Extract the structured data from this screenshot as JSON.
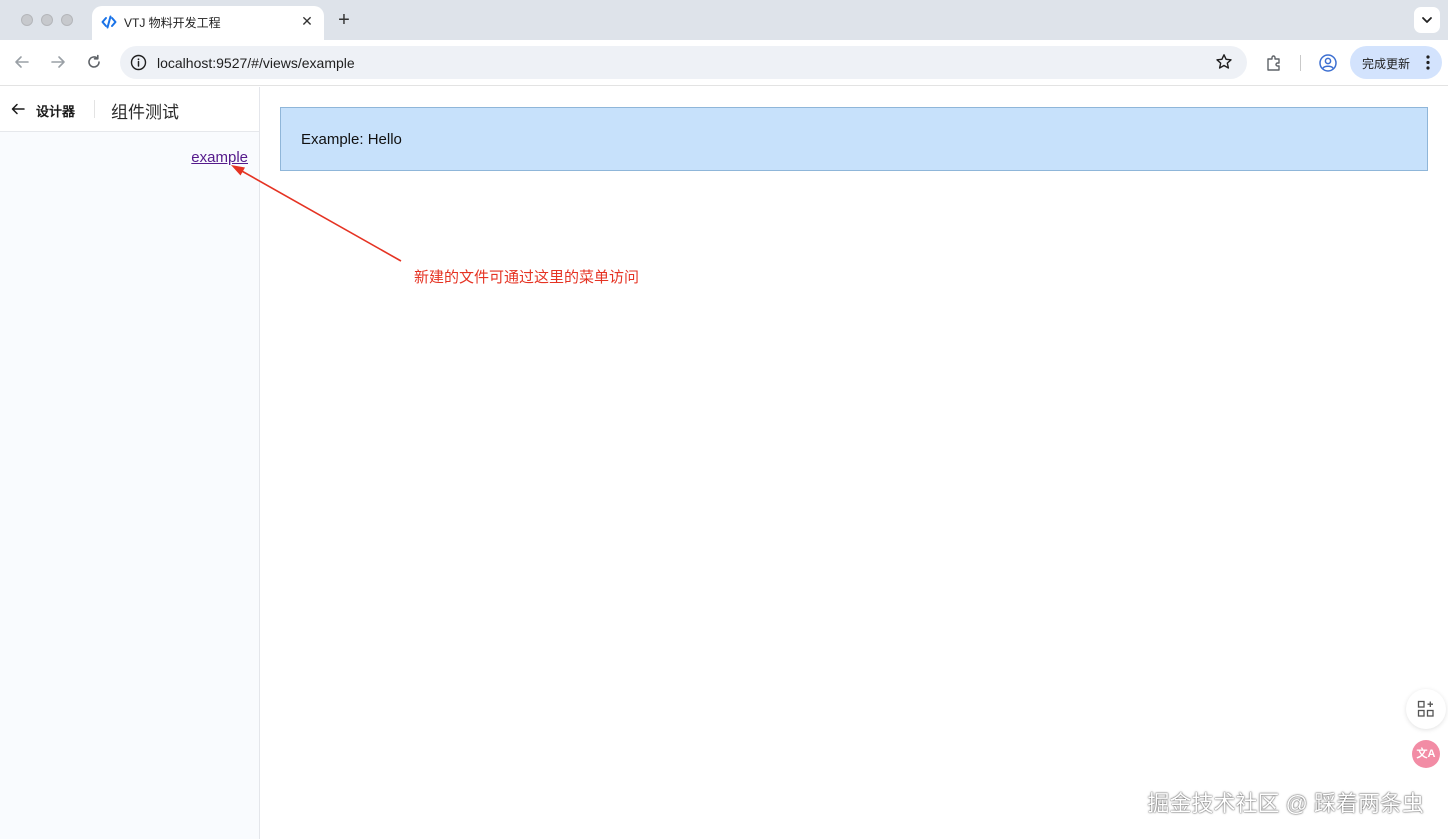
{
  "browser": {
    "tab_title": "VTJ 物料开发工程",
    "tab_close": "✕",
    "new_tab": "+",
    "url": "localhost:9527/#/views/example",
    "update_button": "完成更新",
    "accent_color": "#1a73e8"
  },
  "sidebar": {
    "designer_label": "设计器",
    "page_title": "组件测试",
    "menu_items": [
      {
        "label": "example"
      }
    ]
  },
  "content": {
    "example_text": "Example: Hello",
    "box_color": "#c7e1fb"
  },
  "annotation": {
    "text": "新建的文件可通过这里的菜单访问",
    "color": "#e53323"
  },
  "floating": {
    "apps_icon": "apps-plus-icon",
    "translate_label": "文A"
  },
  "watermark": "掘金技术社区 @ 踩着两条虫"
}
